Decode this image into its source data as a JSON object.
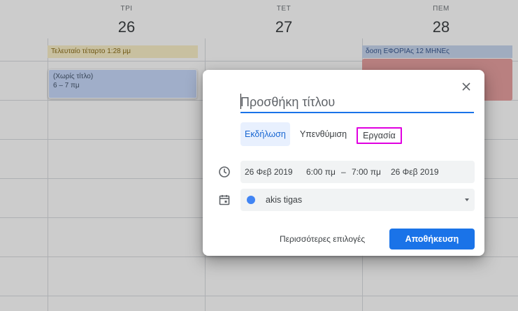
{
  "calendar": {
    "days": [
      {
        "dow": "ΤΡΙ",
        "num": "26"
      },
      {
        "dow": "ΤΕΤ",
        "num": "27"
      },
      {
        "dow": "ΠΕΜ",
        "num": "28"
      }
    ],
    "allday_events": [
      {
        "text": "Τελευταίο τέταρτο 1:28 μμ",
        "color": "#fbf0c8"
      },
      {
        "text": "δοση ΕΦΟΡΙΑς 12 ΜΗΝΕς",
        "color": "#c9d7ef"
      }
    ],
    "events": [
      {
        "title": "(Χωρίς τίτλο)",
        "time": "6 – 7 πμ",
        "color": "#c8dafc"
      }
    ],
    "red_event_color": "#e8a0a0"
  },
  "dialog": {
    "title_placeholder": "Προσθήκη τίτλου",
    "close_icon": "close-icon",
    "tabs": [
      {
        "label": "Εκδήλωση",
        "active": true
      },
      {
        "label": "Υπενθύμιση",
        "active": false
      },
      {
        "label": "Εργασία",
        "active": false
      }
    ],
    "datetime": {
      "start_date": "26 Φεβ 2019",
      "start_time": "6:00 πμ",
      "separator": "–",
      "end_time": "7:00 πμ",
      "end_date": "26 Φεβ 2019"
    },
    "calendar_owner": "akis tigas",
    "more_options_label": "Περισσότερες επιλογές",
    "save_label": "Αποθήκευση",
    "accent_color": "#1a73e8"
  }
}
